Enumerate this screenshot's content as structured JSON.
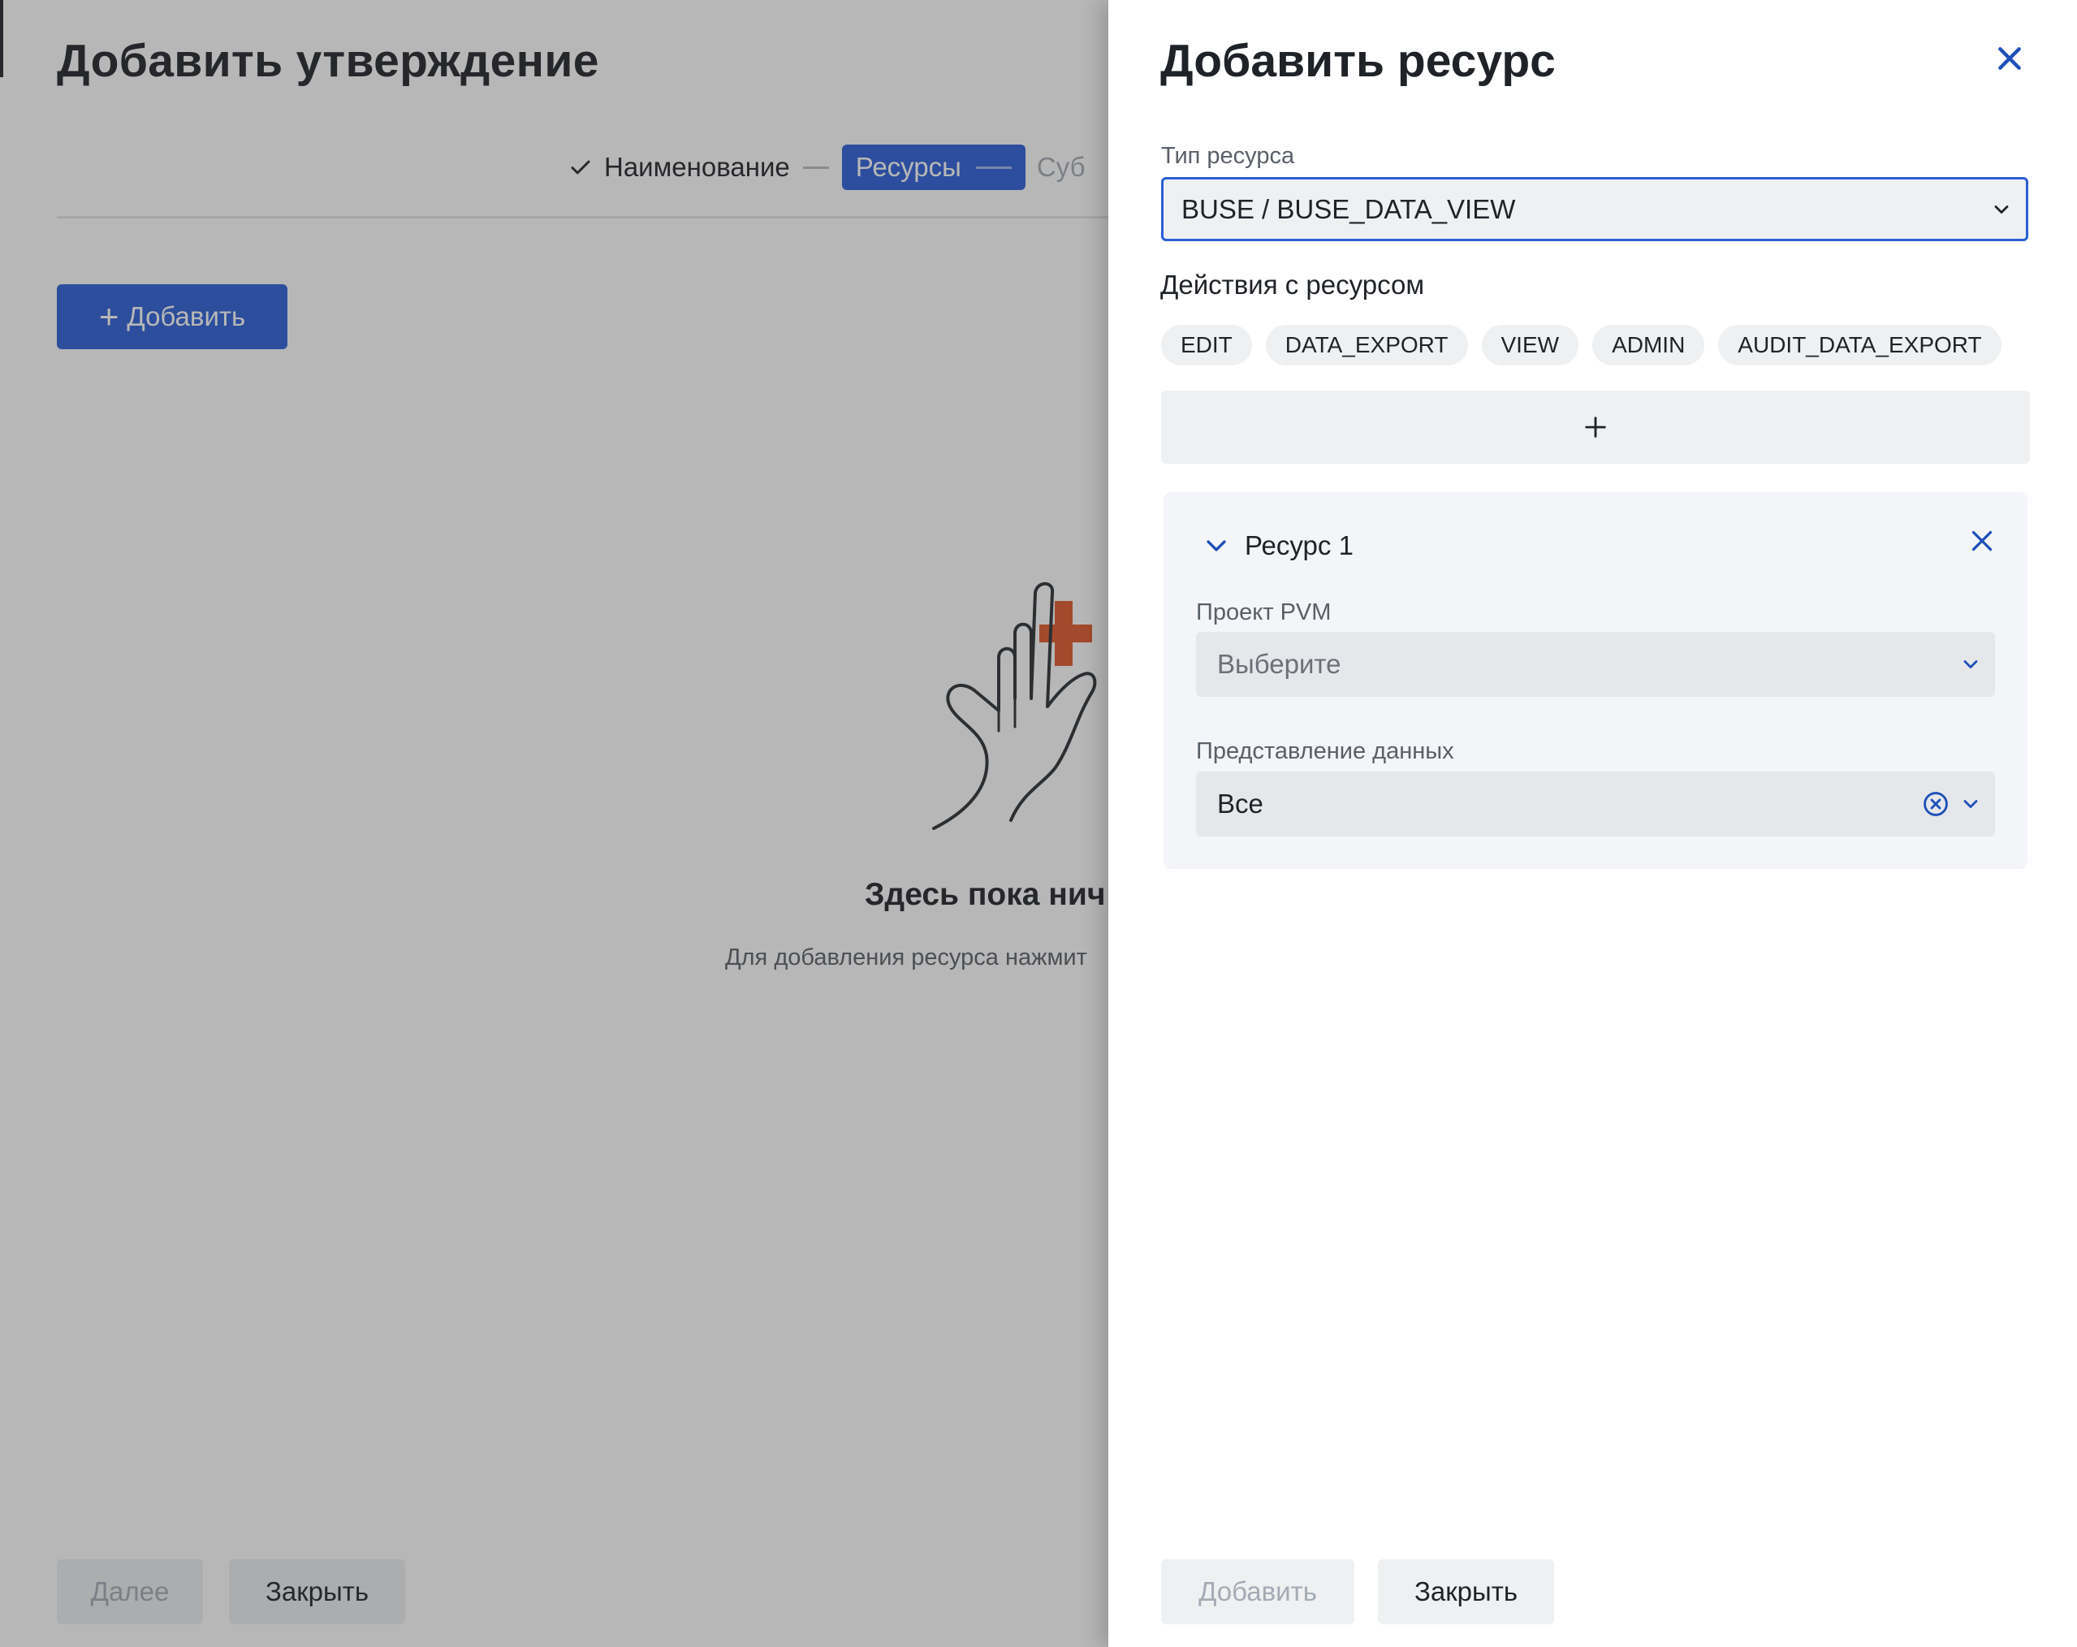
{
  "background_page": {
    "title": "Добавить утверждение",
    "stepper": {
      "steps": [
        {
          "label": "Наименование",
          "state": "done"
        },
        {
          "label": "Ресурсы",
          "state": "active"
        },
        {
          "label": "Суб",
          "state": "future"
        }
      ]
    },
    "add_button_label": "Добавить",
    "empty_state": {
      "title": "Здесь пока нич",
      "subtitle": "Для добавления ресурса нажмит"
    },
    "footer": {
      "next_label": "Далее",
      "close_label": "Закрыть"
    }
  },
  "drawer": {
    "title": "Добавить ресурс",
    "resource_type": {
      "label": "Тип ресурса",
      "value": "BUSE / BUSE_DATA_VIEW"
    },
    "actions": {
      "title": "Действия с ресурсом",
      "chips": [
        "EDIT",
        "DATA_EXPORT",
        "VIEW",
        "ADMIN",
        "AUDIT_DATA_EXPORT"
      ]
    },
    "resource_card": {
      "title": "Ресурс 1",
      "project": {
        "label": "Проект PVM",
        "placeholder": "Выберите"
      },
      "data_view": {
        "label": "Представление данных",
        "value": "Все"
      }
    },
    "footer": {
      "add_label": "Добавить",
      "close_label": "Закрыть"
    }
  },
  "colors": {
    "accent": "#2a5fd6",
    "illustration_plus": "#e0582a"
  },
  "icons": [
    "check-icon",
    "plus-icon",
    "close-icon",
    "chevron-down-icon",
    "clear-circle-icon"
  ]
}
